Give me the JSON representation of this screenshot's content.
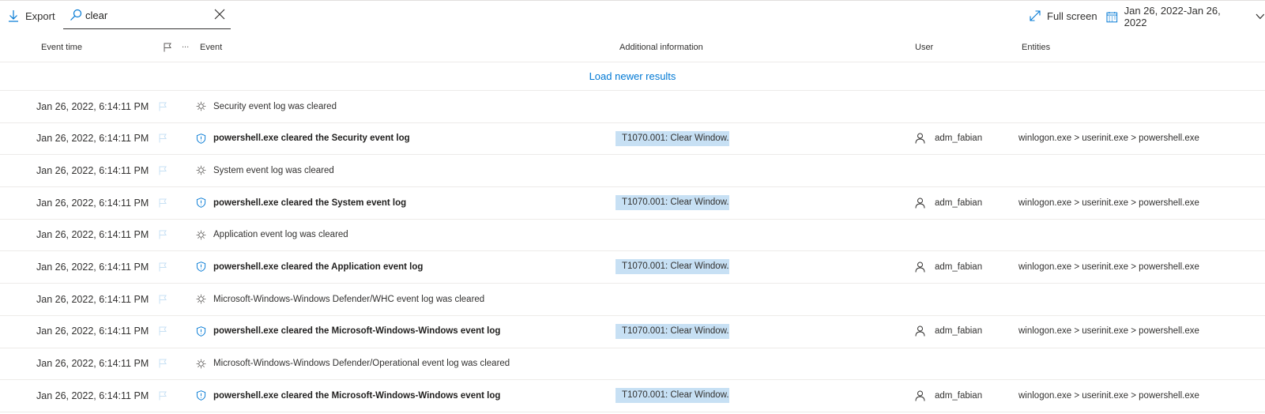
{
  "toolbar": {
    "export_label": "Export",
    "search_value": "clear",
    "fullscreen_label": "Full screen",
    "date_range": "Jan 26, 2022-Jan 26, 2022"
  },
  "columns": {
    "event_time": "Event time",
    "more": "...",
    "event": "Event",
    "additional_info": "Additional information",
    "user": "User",
    "entities": "Entities"
  },
  "load_newer": "Load newer results",
  "colors": {
    "accent": "#0078d4",
    "tag_bg": "#c7e0f4",
    "flag": "#c7e0f4"
  },
  "rows": [
    {
      "time": "Jan 26, 2022, 6:14:11 PM",
      "icon": "gear-icon",
      "event": "Security event log was cleared",
      "bold": false,
      "info": "",
      "user": "",
      "entities": ""
    },
    {
      "time": "Jan 26, 2022, 6:14:11 PM",
      "icon": "shield-icon",
      "event": "powershell.exe cleared the Security event log",
      "bold": true,
      "info": "T1070.001: Clear Window...",
      "user": "adm_fabian",
      "entities": "winlogon.exe > userinit.exe > powershell.exe"
    },
    {
      "time": "Jan 26, 2022, 6:14:11 PM",
      "icon": "gear-icon",
      "event": "System event log was cleared",
      "bold": false,
      "info": "",
      "user": "",
      "entities": ""
    },
    {
      "time": "Jan 26, 2022, 6:14:11 PM",
      "icon": "shield-icon",
      "event": "powershell.exe cleared the System event log",
      "bold": true,
      "info": "T1070.001: Clear Window...",
      "user": "adm_fabian",
      "entities": "winlogon.exe > userinit.exe > powershell.exe"
    },
    {
      "time": "Jan 26, 2022, 6:14:11 PM",
      "icon": "gear-icon",
      "event": "Application event log was cleared",
      "bold": false,
      "info": "",
      "user": "",
      "entities": ""
    },
    {
      "time": "Jan 26, 2022, 6:14:11 PM",
      "icon": "shield-icon",
      "event": "powershell.exe cleared the Application event log",
      "bold": true,
      "info": "T1070.001: Clear Window...",
      "user": "adm_fabian",
      "entities": "winlogon.exe > userinit.exe > powershell.exe"
    },
    {
      "time": "Jan 26, 2022, 6:14:11 PM",
      "icon": "gear-icon",
      "event": "Microsoft-Windows-Windows Defender/WHC event log was cleared",
      "bold": false,
      "info": "",
      "user": "",
      "entities": ""
    },
    {
      "time": "Jan 26, 2022, 6:14:11 PM",
      "icon": "shield-icon",
      "event": "powershell.exe cleared the Microsoft-Windows-Windows event log",
      "bold": true,
      "info": "T1070.001: Clear Window...",
      "user": "adm_fabian",
      "entities": "winlogon.exe > userinit.exe > powershell.exe"
    },
    {
      "time": "Jan 26, 2022, 6:14:11 PM",
      "icon": "gear-icon",
      "event": "Microsoft-Windows-Windows Defender/Operational event log was cleared",
      "bold": false,
      "info": "",
      "user": "",
      "entities": ""
    },
    {
      "time": "Jan 26, 2022, 6:14:11 PM",
      "icon": "shield-icon",
      "event": "powershell.exe cleared the Microsoft-Windows-Windows event log",
      "bold": true,
      "info": "T1070.001: Clear Window...",
      "user": "adm_fabian",
      "entities": "winlogon.exe > userinit.exe > powershell.exe"
    }
  ]
}
